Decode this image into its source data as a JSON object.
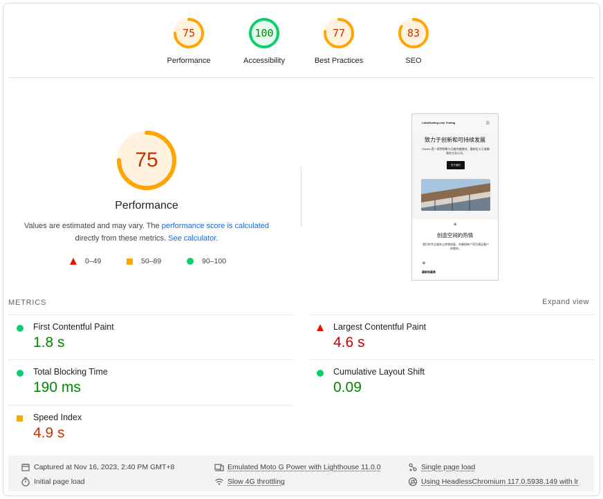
{
  "colors": {
    "pass": "#0cce6b",
    "average": "#ffa400",
    "fail": "#eb0f00",
    "pass_text": "#008800",
    "average_text": "#c33300",
    "fail_text": "#cc0000",
    "link": "#1967d2"
  },
  "gauges": [
    {
      "label": "Performance",
      "score": 75,
      "rating": "average"
    },
    {
      "label": "Accessibility",
      "score": 100,
      "rating": "pass"
    },
    {
      "label": "Best Practices",
      "score": 77,
      "rating": "average"
    },
    {
      "label": "SEO",
      "score": 83,
      "rating": "average"
    }
  ],
  "main": {
    "score": 75,
    "title": "Performance",
    "estimate_text_1": "Values are estimated and may vary. The ",
    "estimate_link_1": "performance score is calculated",
    "estimate_text_2": "directly from these metrics. ",
    "estimate_link_2": "See calculator",
    "estimate_text_3": "."
  },
  "legend": [
    {
      "range": "0–49",
      "shape": "triangle-icon"
    },
    {
      "range": "50–89",
      "shape": "square-icon"
    },
    {
      "range": "90–100",
      "shape": "circle-icon"
    }
  ],
  "screenshot": {
    "brand": "LaksHosting.com Testing",
    "menu": "☰",
    "hero_title": "致力于创新和可持续发展",
    "hero_text": "Etudes 是一家将想象与功能完美融合，重新定义王者精致的主导公司。",
    "hero_button": "关于我们",
    "section_title": "创造空间的热情",
    "section_text": "我们的专业服务让梦想成真，并确保每个项目满足客户的需求。",
    "footer_title": "最新和最美",
    "star": "✳"
  },
  "metrics_section": {
    "title": "METRICS",
    "expand": "Expand view"
  },
  "metrics": [
    {
      "name": "First Contentful Paint",
      "value": "1.8 s",
      "rating": "pass"
    },
    {
      "name": "Largest Contentful Paint",
      "value": "4.6 s",
      "rating": "fail"
    },
    {
      "name": "Total Blocking Time",
      "value": "190 ms",
      "rating": "pass"
    },
    {
      "name": "Cumulative Layout Shift",
      "value": "0.09",
      "rating": "pass"
    },
    {
      "name": "Speed Index",
      "value": "4.9 s",
      "rating": "average"
    }
  ],
  "footer": {
    "captured": "Captured at Nov 16, 2023, 2:40 PM GMT+8",
    "initial_load": "Initial page load",
    "device": "Emulated Moto G Power with Lighthouse 11.0.0",
    "throttling": "Slow 4G throttling",
    "session": "Single page load",
    "browser": "Using HeadlessChromium 117.0.5938.149 with lr"
  }
}
